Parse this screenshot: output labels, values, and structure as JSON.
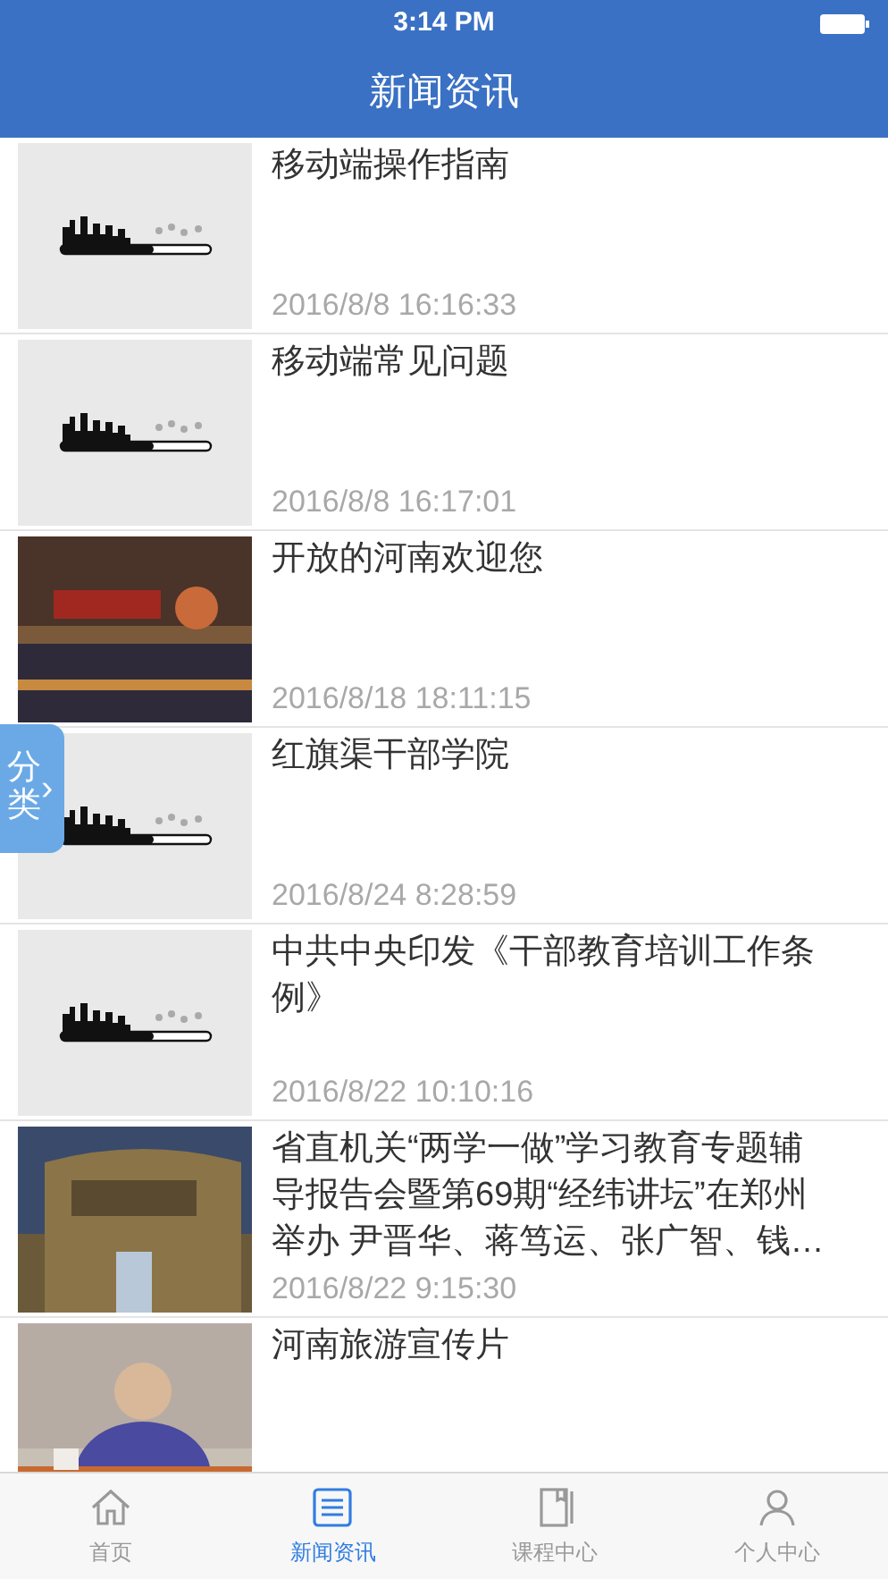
{
  "status_bar": {
    "time": "3:14 PM"
  },
  "nav": {
    "title": "新闻资讯"
  },
  "articles": [
    {
      "title": "移动端操作指南",
      "date": "2016/8/8 16:16:33",
      "kind": "loading"
    },
    {
      "title": "移动端常见问题",
      "date": "2016/8/8 16:17:01",
      "kind": "loading"
    },
    {
      "title": "开放的河南欢迎您",
      "date": "2016/8/18 18:11:15",
      "kind": "picture"
    },
    {
      "title": "红旗渠干部学院",
      "date": "2016/8/24 8:28:59",
      "kind": "loading"
    },
    {
      "title": "中共中央印发《干部教育培训工作条例》",
      "date": "2016/8/22 10:10:16",
      "kind": "loading"
    },
    {
      "title": "省直机关“两学一做”学习教育专题辅导报告会暨第69期“经纬讲坛”在郑州举办 尹晋华、蒋笃运、张广智、钱…",
      "date": "2016/8/22 9:15:30",
      "kind": "picture"
    },
    {
      "title": "河南旅游宣传片",
      "kind": "picture"
    }
  ],
  "side_tab": {
    "label": "分类",
    "arrow": "›"
  },
  "tabs": [
    {
      "label": "首页",
      "selected": false
    },
    {
      "label": "新闻资讯",
      "selected": true
    },
    {
      "label": "课程中心",
      "selected": false
    },
    {
      "label": "个人中心",
      "selected": false
    }
  ]
}
